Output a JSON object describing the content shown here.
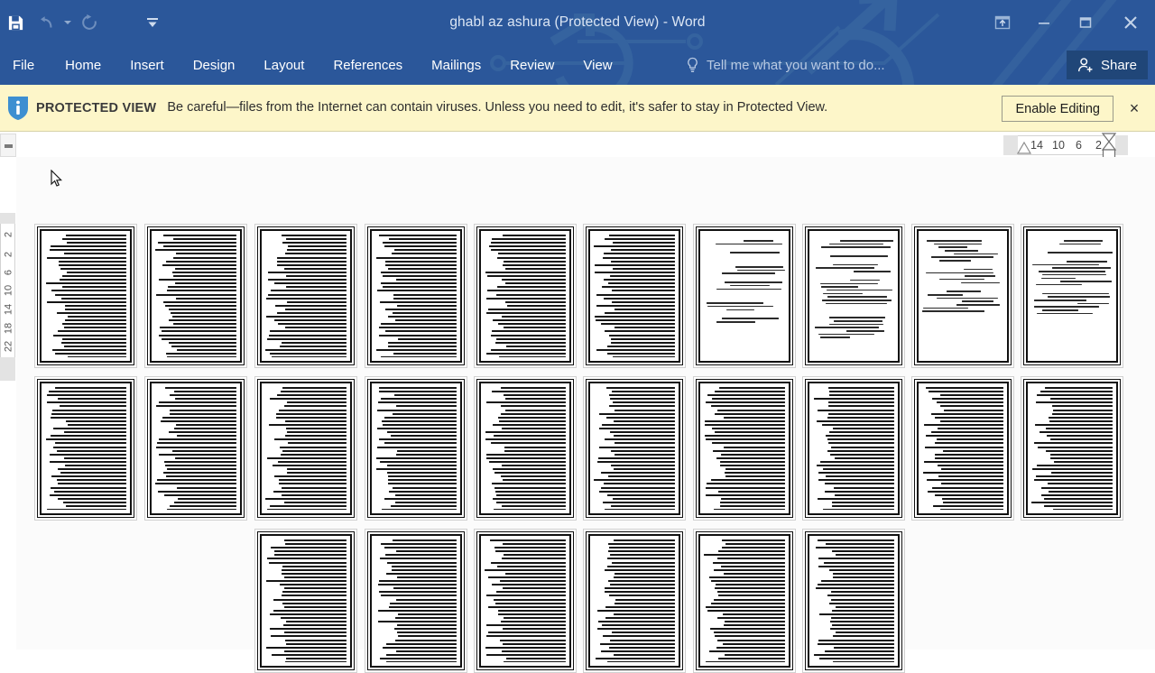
{
  "window": {
    "title": "ghabl az ashura (Protected View) - Word",
    "accent_color": "#2b579a",
    "controls": [
      {
        "name": "ribbon-display-options",
        "label": "Ribbon Display Options"
      },
      {
        "name": "minimize",
        "label": "Minimize"
      },
      {
        "name": "restore",
        "label": "Restore Down"
      },
      {
        "name": "close",
        "label": "Close"
      }
    ]
  },
  "quick_access": {
    "items": [
      {
        "name": "save",
        "label": "Save",
        "enabled": true
      },
      {
        "name": "undo",
        "label": "Undo",
        "enabled": false
      },
      {
        "name": "redo",
        "label": "Repeat",
        "enabled": false
      },
      {
        "name": "customize",
        "label": "Customize Quick Access Toolbar",
        "enabled": true
      }
    ]
  },
  "ribbon": {
    "tabs": [
      {
        "label": "File"
      },
      {
        "label": "Home"
      },
      {
        "label": "Insert"
      },
      {
        "label": "Design"
      },
      {
        "label": "Layout"
      },
      {
        "label": "References"
      },
      {
        "label": "Mailings"
      },
      {
        "label": "Review"
      },
      {
        "label": "View"
      }
    ],
    "tell_me": "Tell me what you want to do...",
    "share_label": "Share"
  },
  "protected_view": {
    "label": "PROTECTED VIEW",
    "message": "Be careful—files from the Internet can contain viruses. Unless you need to edit, it's safer to stay in Protected View.",
    "enable_button": "Enable Editing",
    "close_label": "×",
    "background_color": "#fdf6c9"
  },
  "rulers": {
    "horizontal_ticks": [
      "14",
      "10",
      "6",
      "2"
    ],
    "vertical_ticks": [
      "2",
      "2",
      "6",
      "10",
      "14",
      "18",
      "22"
    ]
  },
  "document": {
    "zoom_view": "multiple-pages",
    "columns": 10,
    "pages": [
      {
        "index": 1,
        "row": 1,
        "col": 1,
        "density": "dense"
      },
      {
        "index": 2,
        "row": 1,
        "col": 2,
        "density": "dense"
      },
      {
        "index": 3,
        "row": 1,
        "col": 3,
        "density": "dense"
      },
      {
        "index": 4,
        "row": 1,
        "col": 4,
        "density": "dense"
      },
      {
        "index": 5,
        "row": 1,
        "col": 5,
        "density": "dense"
      },
      {
        "index": 6,
        "row": 1,
        "col": 6,
        "density": "dense"
      },
      {
        "index": 7,
        "row": 1,
        "col": 7,
        "density": "sparse"
      },
      {
        "index": 8,
        "row": 1,
        "col": 8,
        "density": "mixed"
      },
      {
        "index": 9,
        "row": 1,
        "col": 9,
        "density": "sparse"
      },
      {
        "index": 10,
        "row": 1,
        "col": 10,
        "density": "sparse"
      },
      {
        "index": 11,
        "row": 2,
        "col": 1,
        "density": "dense"
      },
      {
        "index": 12,
        "row": 2,
        "col": 2,
        "density": "dense"
      },
      {
        "index": 13,
        "row": 2,
        "col": 3,
        "density": "dense"
      },
      {
        "index": 14,
        "row": 2,
        "col": 4,
        "density": "dense"
      },
      {
        "index": 15,
        "row": 2,
        "col": 5,
        "density": "dense"
      },
      {
        "index": 16,
        "row": 2,
        "col": 6,
        "density": "dense"
      },
      {
        "index": 17,
        "row": 2,
        "col": 7,
        "density": "dense"
      },
      {
        "index": 18,
        "row": 2,
        "col": 8,
        "density": "dense"
      },
      {
        "index": 19,
        "row": 2,
        "col": 9,
        "density": "dense"
      },
      {
        "index": 20,
        "row": 2,
        "col": 10,
        "density": "dense"
      },
      {
        "index": 21,
        "row": 3,
        "col": 3,
        "density": "dense"
      },
      {
        "index": 22,
        "row": 3,
        "col": 4,
        "density": "dense"
      },
      {
        "index": 23,
        "row": 3,
        "col": 5,
        "density": "dense"
      },
      {
        "index": 24,
        "row": 3,
        "col": 6,
        "density": "dense"
      },
      {
        "index": 25,
        "row": 3,
        "col": 7,
        "density": "dense"
      },
      {
        "index": 26,
        "row": 3,
        "col": 8,
        "density": "dense"
      }
    ]
  }
}
